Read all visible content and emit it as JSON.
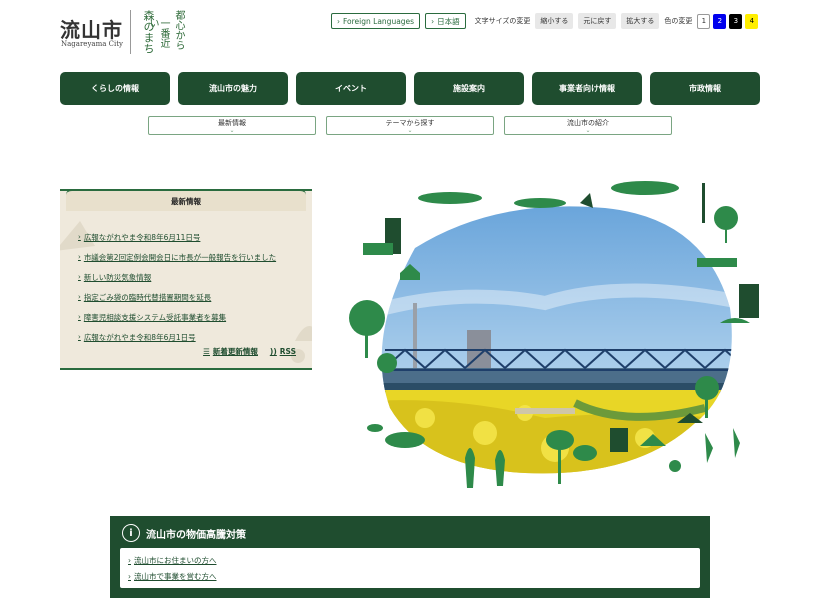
{
  "logo": {
    "name": "流山市",
    "sub": "Nagareyama City",
    "tagline": [
      "都心から",
      "一番近い",
      "森のまち"
    ]
  },
  "topbar": {
    "foreign_languages": "Foreign Languages",
    "japanese": "日本語",
    "font_size_label": "文字サイズの変更",
    "shrink": "縮小する",
    "reset": "元に戻す",
    "enlarge": "拡大する",
    "color_label": "色の変更",
    "colors": [
      {
        "label": "1",
        "bg": "#ffffff",
        "fg": "#333333"
      },
      {
        "label": "2",
        "bg": "#0000ee",
        "fg": "#ffffff"
      },
      {
        "label": "3",
        "bg": "#000000",
        "fg": "#ffffff"
      },
      {
        "label": "4",
        "bg": "#ffee00",
        "fg": "#000000"
      }
    ]
  },
  "mainnav": [
    "くらしの情報",
    "流山市の魅力",
    "イベント",
    "施設案内",
    "事業者向け情報",
    "市政情報"
  ],
  "subnav": [
    "最新情報",
    "テーマから探す",
    "流山市の紹介"
  ],
  "news": {
    "title": "最新情報",
    "items": [
      "広報ながれやま令和8年6月11日号",
      "市議会第2回定例会開会日に市長が一般報告を行いました",
      "新しい防災気象情報",
      "指定ごみ袋の臨時代替措置期間を延長",
      "障害児相談支援システム受託事業者を募集",
      "広報ながれやま令和8年6月1日号"
    ],
    "more": "新着更新情報",
    "rss": "RSS"
  },
  "measures": {
    "title": "流山市の物価高騰対策",
    "links": [
      "流山市にお住まいの方へ",
      "流山市で事業を営む方へ"
    ]
  },
  "colors": {
    "brand_green": "#1f4d2f",
    "accent_green": "#2a6b3e",
    "news_bg": "#efe9dc"
  }
}
